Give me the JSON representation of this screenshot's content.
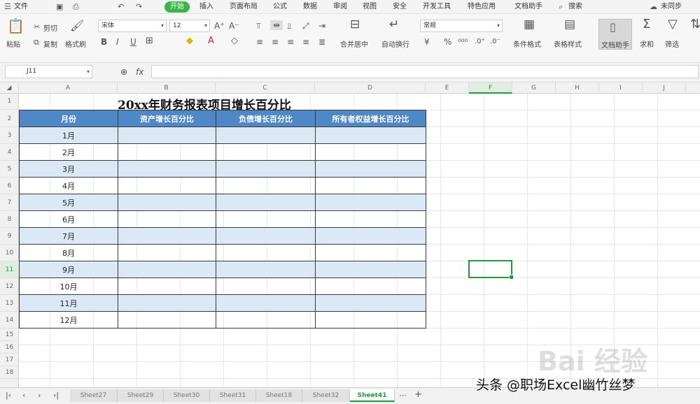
{
  "menubar": {
    "items": [
      "文件",
      "开始",
      "插入",
      "页面布局",
      "公式",
      "数据",
      "审阅",
      "视图",
      "安全",
      "开发工具",
      "特色应用",
      "文档助手"
    ],
    "search": "搜索",
    "sync": "未同步"
  },
  "toolbar": {
    "paste": "粘贴",
    "cut": "剪切",
    "copy": "复制",
    "format_painter": "格式刷",
    "font_name": "宋体",
    "font_size": "12",
    "number_format": "常规",
    "merge_center": "合并居中",
    "wrap_text": "自动换行",
    "conditional_format": "条件格式",
    "table_style": "表格样式",
    "doc_helper": "文档助手",
    "sum": "求和",
    "filter": "筛选"
  },
  "formula_bar": {
    "cell_ref": "J11",
    "fx": "fx",
    "value": ""
  },
  "columns": [
    "A",
    "B",
    "C",
    "D",
    "E",
    "F",
    "G",
    "H",
    "I",
    "J"
  ],
  "rows": [
    "1",
    "2",
    "3",
    "4",
    "5",
    "6",
    "7",
    "8",
    "9",
    "10",
    "11",
    "12",
    "13",
    "14",
    "15",
    "16",
    "17",
    "18"
  ],
  "sheet": {
    "title": "20xx年财务报表项目增长百分比",
    "headers": [
      "月份",
      "资产增长百分比",
      "负债增长百分比",
      "所有者权益增长百分比"
    ],
    "months": [
      "1月",
      "2月",
      "3月",
      "4月",
      "5月",
      "6月",
      "7月",
      "8月",
      "9月",
      "10月",
      "11月",
      "12月"
    ]
  },
  "sheet_tabs": [
    "Sheet27",
    "Sheet29",
    "Sheet30",
    "Sheet31",
    "Sheet18",
    "Sheet32",
    "Sheet41"
  ],
  "active_tab": "Sheet41",
  "watermark": "头条 @职场Excel幽竹丝梦",
  "baidu": "Bai 经验",
  "colors": {
    "accent": "#3bb44a",
    "header_fill": "#4f88c6",
    "band_fill": "#dbe8f6",
    "selection": "#1f9a3a"
  }
}
